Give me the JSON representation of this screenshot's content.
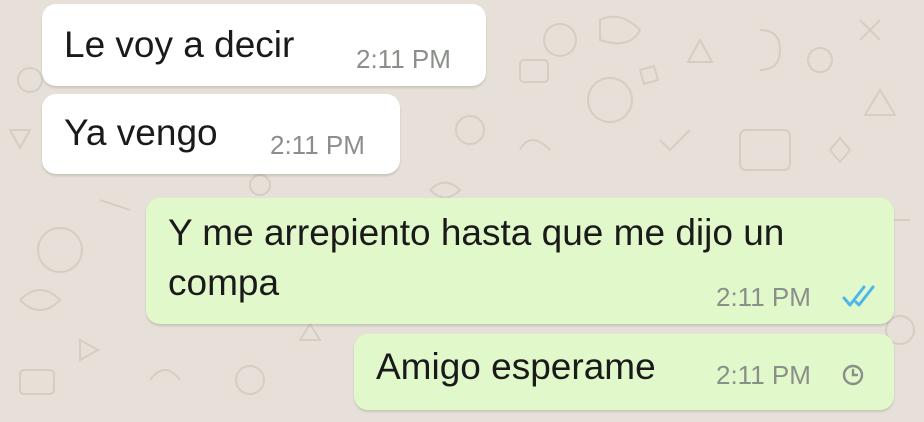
{
  "chat": {
    "messages": [
      {
        "direction": "incoming",
        "text": "Le voy a decir",
        "time": "2:11 PM"
      },
      {
        "direction": "incoming",
        "text": "Ya vengo",
        "time": "2:11 PM"
      },
      {
        "direction": "outgoing",
        "lines": [
          "Y me arrepiento hasta que me dijo un",
          "compa"
        ],
        "time": "2:11 PM",
        "status_icon": "double-check-read-icon"
      },
      {
        "direction": "outgoing",
        "text": "Amigo esperame",
        "time": "2:11 PM",
        "status_icon": "clock-pending-icon"
      }
    ]
  },
  "colors": {
    "background": "#e6e0d8",
    "incoming_bubble": "#ffffff",
    "outgoing_bubble": "#e1f8cb",
    "timestamp": "#8b8f8a",
    "read_tick": "#4fb6ec"
  }
}
